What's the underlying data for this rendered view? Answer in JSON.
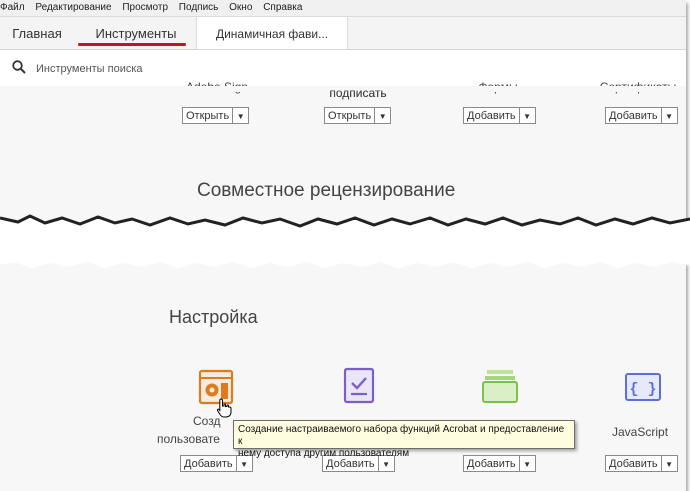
{
  "menubar": {
    "items": [
      "Файл",
      "Редактирование",
      "Просмотр",
      "Подпись",
      "Окно",
      "Справка"
    ]
  },
  "tabs": {
    "home": "Главная",
    "tools": "Инструменты",
    "document": "Динамичная фави..."
  },
  "search": {
    "placeholder": "Инструменты поиска"
  },
  "top_tools": [
    {
      "label": "Adobe Sign",
      "button": "Открыть"
    },
    {
      "label": "подписать",
      "button": "Открыть"
    },
    {
      "label": "Формы",
      "button": "Добавить"
    },
    {
      "label": "Сертификаты",
      "button": "Добавить"
    }
  ],
  "section_review": "Совместное рецензирование",
  "section_settings": "Настройка",
  "bottom_tools": [
    {
      "label": "Созд",
      "label2": "пользовате",
      "button": "Добавить",
      "icon": "gear-box-icon",
      "color": "#e07a1f"
    },
    {
      "label": "",
      "button": "Добавить",
      "icon": "checklist-icon",
      "color": "#7b5fc7"
    },
    {
      "label": "",
      "button": "Добавить",
      "icon": "folder-green-icon",
      "color": "#7bc142"
    },
    {
      "label": "JavaScript",
      "button": "Добавить",
      "icon": "braces-icon",
      "color": "#5b6fd6"
    }
  ],
  "tooltip": {
    "line1": "Создание настраиваемого набора функций Acrobat и предоставление к",
    "line2": "нему доступа другим пользователям"
  },
  "colors": {
    "accent_underline": "#c5141b"
  }
}
